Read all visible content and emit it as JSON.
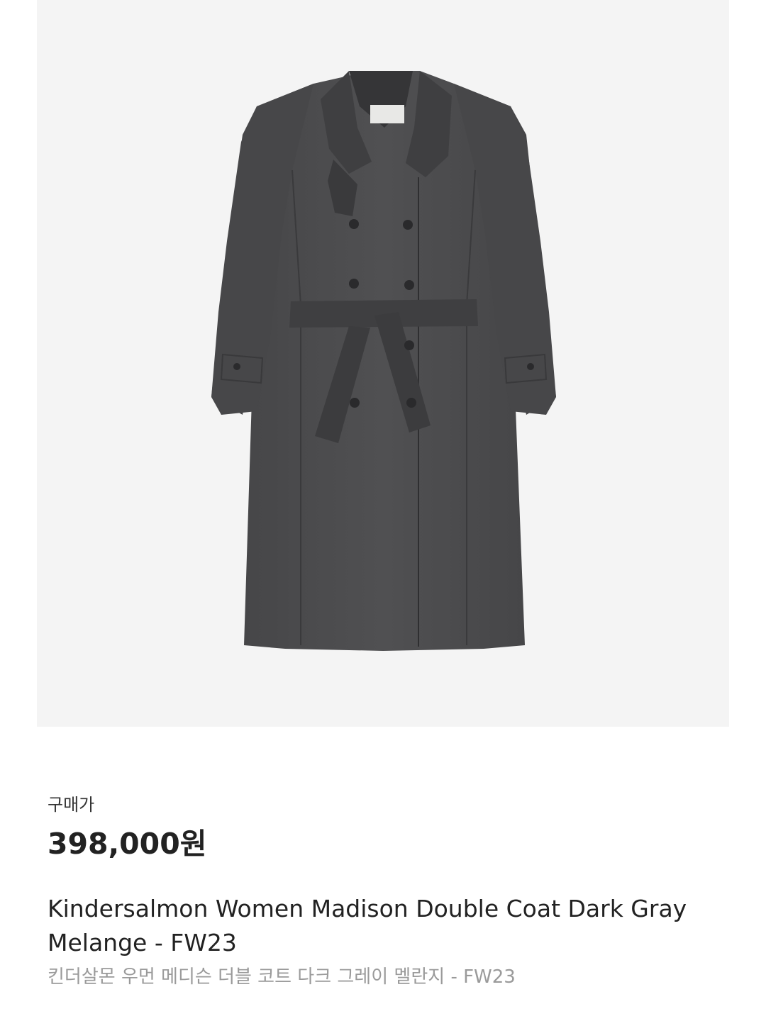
{
  "product": {
    "image_alt": "coat-product-image",
    "background_color": "#f4f4f4",
    "coat_color": "#4a4a4c"
  },
  "price": {
    "label": "구매가",
    "value": "398,000원"
  },
  "title": {
    "english": "Kindersalmon Women Madison Double Coat Dark Gray Melange - FW23",
    "korean": "킨더살몬 우먼 메디슨 더블 코트 다크 그레이 멜란지 - FW23"
  }
}
